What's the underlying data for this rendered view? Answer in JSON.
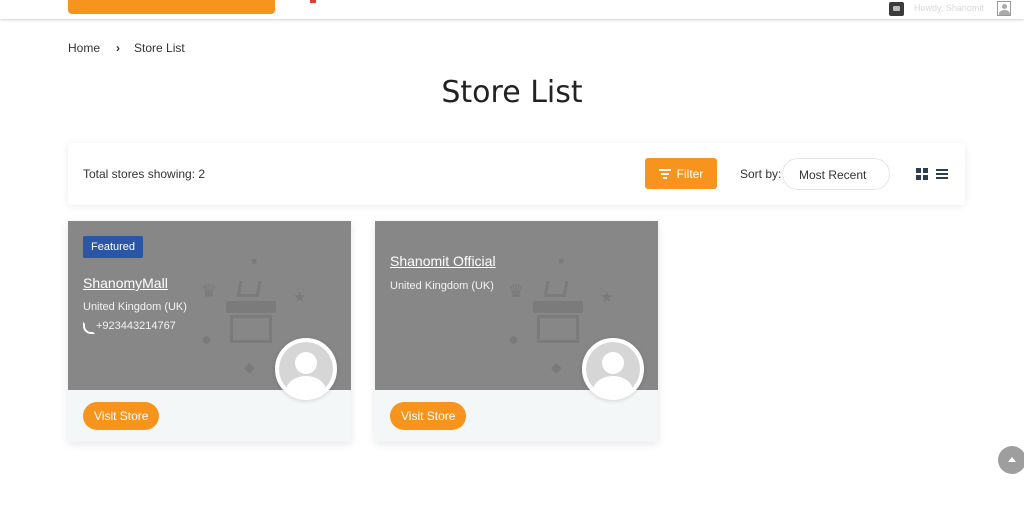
{
  "topbar": {
    "howdy_text": "Howdy, Shanomit",
    "accent_color": "#f7941d"
  },
  "breadcrumb": {
    "home": "Home",
    "separator": "›",
    "current": "Store List"
  },
  "page": {
    "title": "Store List"
  },
  "toolbar": {
    "total_text": "Total stores showing: 2",
    "filter_label": "Filter",
    "sort_label": "Sort by:",
    "sort_value": "Most Recent",
    "view_modes": [
      "grid-icon",
      "list-icon"
    ]
  },
  "stores": [
    {
      "badge": "Featured",
      "name": "ShanomyMall",
      "location": "United Kingdom (UK)",
      "phone": "+923443214767",
      "visit_label": "Visit Store"
    },
    {
      "name": "Shanomit Official",
      "location": "United Kingdom (UK)",
      "visit_label": "Visit Store"
    }
  ],
  "colors": {
    "orange": "#f7941d",
    "featured_blue": "#2a56a5",
    "banner_gray": "#878787"
  }
}
